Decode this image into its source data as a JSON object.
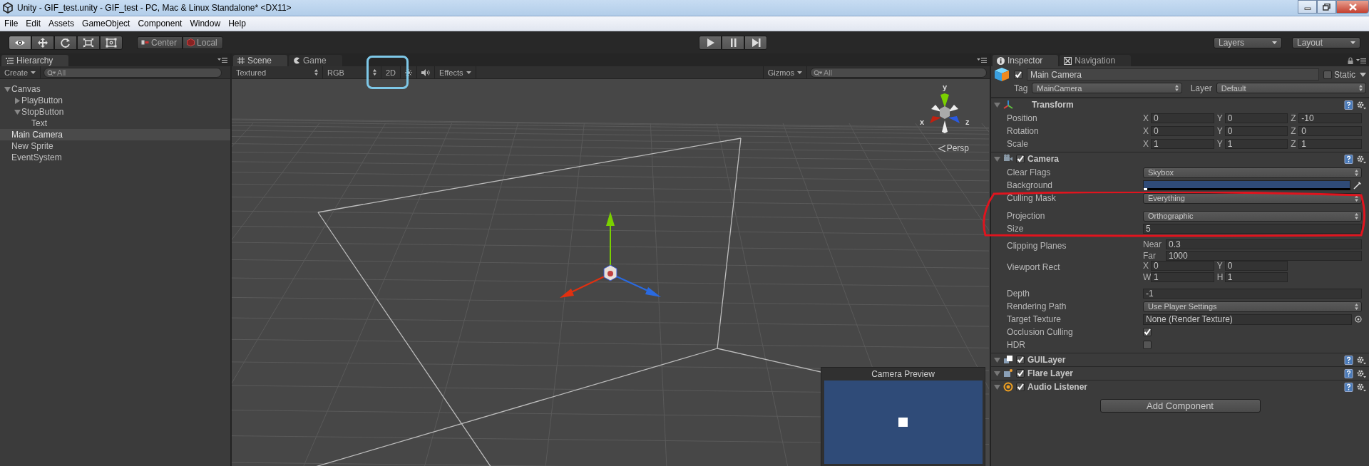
{
  "window": {
    "title": "Unity - GIF_test.unity - GIF_test - PC, Mac & Linux Standalone* <DX11>"
  },
  "menu": [
    "File",
    "Edit",
    "Assets",
    "GameObject",
    "Component",
    "Window",
    "Help"
  ],
  "toolbar": {
    "tools": [
      {
        "kind": "view",
        "selected": true
      },
      {
        "kind": "move",
        "selected": false
      },
      {
        "kind": "rotate",
        "selected": false
      },
      {
        "kind": "scale",
        "selected": false
      },
      {
        "kind": "rect",
        "selected": false
      }
    ],
    "pivot": [
      {
        "kind": "center",
        "label": "Center"
      },
      {
        "kind": "local",
        "label": "Local"
      }
    ],
    "playback": [
      {
        "kind": "play"
      },
      {
        "kind": "pause"
      },
      {
        "kind": "step"
      }
    ],
    "layers": "Layers",
    "layout": "Layout"
  },
  "hierarchy": {
    "title": "Hierarchy",
    "create": "Create",
    "search": {
      "placeholder": "All"
    },
    "items": [
      {
        "label": "Canvas",
        "selected": false,
        "expanded": true,
        "children": [
          {
            "label": "PlayButton",
            "selected": false,
            "expanded": false
          },
          {
            "label": "StopButton",
            "selected": false,
            "expanded": true,
            "children": [
              {
                "label": "Text",
                "selected": false
              }
            ]
          }
        ]
      },
      {
        "label": "Main Camera",
        "selected": true
      },
      {
        "label": "New Sprite",
        "selected": false
      },
      {
        "label": "EventSystem",
        "selected": false
      }
    ]
  },
  "scene": {
    "tabs": [
      {
        "kind": "scene",
        "label": "Scene",
        "selected": true
      },
      {
        "kind": "game",
        "label": "Game",
        "selected": false
      }
    ],
    "shading": "Textured",
    "render_mode": "RGB",
    "mode_2d": "2D",
    "effects": "Effects",
    "gizmos": "Gizmos",
    "search": {
      "placeholder": "All"
    },
    "axes": {
      "y": "y",
      "x": "x",
      "z": "z"
    },
    "projection": "Persp",
    "preview_title": "Camera Preview"
  },
  "inspector": {
    "tabs": [
      {
        "kind": "inspector",
        "label": "Inspector",
        "selected": true
      },
      {
        "kind": "navigation",
        "label": "Navigation",
        "selected": false
      }
    ],
    "object": {
      "active": true,
      "name": "Main Camera",
      "static": false,
      "static_label": "Static",
      "tag_label": "Tag",
      "tag": "MainCamera",
      "layer_label": "Layer",
      "layer": "Default"
    },
    "components": [
      {
        "kind": "transform",
        "name": "Transform",
        "expanded": true,
        "properties": [
          {
            "kind": "vector",
            "label": "Position",
            "fields": [
              {
                "axis": "X",
                "value": "0"
              },
              {
                "axis": "Y",
                "value": "0"
              },
              {
                "axis": "Z",
                "value": "-10"
              }
            ]
          },
          {
            "kind": "vector",
            "label": "Rotation",
            "fields": [
              {
                "axis": "X",
                "value": "0"
              },
              {
                "axis": "Y",
                "value": "0"
              },
              {
                "axis": "Z",
                "value": "0"
              }
            ]
          },
          {
            "kind": "vector",
            "label": "Scale",
            "fields": [
              {
                "axis": "X",
                "value": "1"
              },
              {
                "axis": "Y",
                "value": "1"
              },
              {
                "axis": "Z",
                "value": "1"
              }
            ]
          }
        ]
      },
      {
        "kind": "camera",
        "name": "Camera",
        "enabled": true,
        "expanded": true,
        "properties": [
          {
            "kind": "dropdown",
            "label": "Clear Flags",
            "value": "Skybox"
          },
          {
            "kind": "color",
            "label": "Background"
          },
          {
            "kind": "dropdown",
            "label": "Culling Mask",
            "value": "Everything"
          },
          {
            "kind": "dropdown",
            "label": "Projection",
            "value": "Orthographic"
          },
          {
            "kind": "number",
            "label": "Size",
            "value": "5"
          },
          {
            "kind": "stacked",
            "label": "Clipping Planes",
            "fields": [
              {
                "axis": "Near",
                "value": "0.3"
              },
              {
                "axis": "Far",
                "value": "1000"
              }
            ]
          },
          {
            "kind": "rect",
            "label": "Viewport Rect",
            "fields": [
              {
                "axis": "X",
                "value": "0"
              },
              {
                "axis": "Y",
                "value": "0"
              },
              {
                "axis": "W",
                "value": "1"
              },
              {
                "axis": "H",
                "value": "1"
              }
            ]
          },
          {
            "kind": "number",
            "label": "Depth",
            "value": "-1"
          },
          {
            "kind": "dropdown",
            "label": "Rendering Path",
            "value": "Use Player Settings"
          },
          {
            "kind": "object",
            "label": "Target Texture",
            "value": "None (Render Texture)"
          },
          {
            "kind": "checkbox",
            "label": "Occlusion Culling",
            "checked": true
          },
          {
            "kind": "checkbox",
            "label": "HDR",
            "checked": false
          }
        ]
      },
      {
        "kind": "guilayer",
        "name": "GUILayer",
        "enabled": true,
        "expanded": true
      },
      {
        "kind": "flare",
        "name": "Flare Layer",
        "enabled": true,
        "expanded": true
      },
      {
        "kind": "audio",
        "name": "Audio Listener",
        "enabled": true,
        "expanded": true
      }
    ],
    "add_component": "Add Component"
  }
}
